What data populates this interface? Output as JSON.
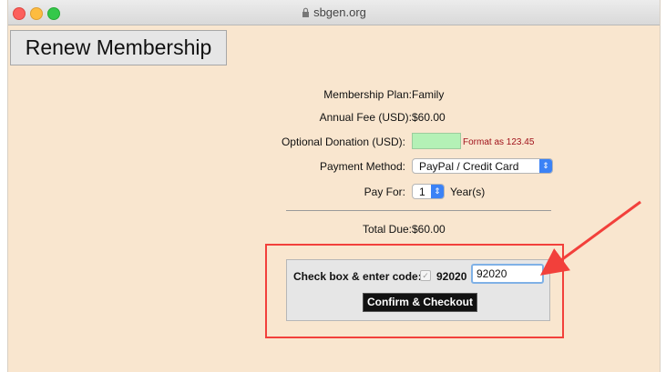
{
  "browser": {
    "url": "sbgen.org"
  },
  "page": {
    "title": "Renew Membership"
  },
  "form": {
    "plan_label": "Membership Plan:",
    "plan_value": "Family",
    "fee_label": "Annual Fee (USD):",
    "fee_value": "$60.00",
    "donation_label": "Optional Donation (USD):",
    "donation_value": "",
    "donation_hint": "Format as 123.45",
    "payment_label": "Payment Method:",
    "payment_value": "PayPal / Credit Card",
    "payfor_label": "Pay For:",
    "payfor_value": "1",
    "payfor_unit": "Year(s)",
    "total_label": "Total Due:",
    "total_value": "$60.00"
  },
  "checkout": {
    "check_label": "Check box & enter code:",
    "code_shown": "92020",
    "code_input_value": "92020",
    "confirm_label": "Confirm & Checkout"
  },
  "colors": {
    "page_bg": "#f9e6cf",
    "annotation": "#f2403b",
    "donation_field": "#b4f1b6",
    "hint": "#a0121b"
  }
}
